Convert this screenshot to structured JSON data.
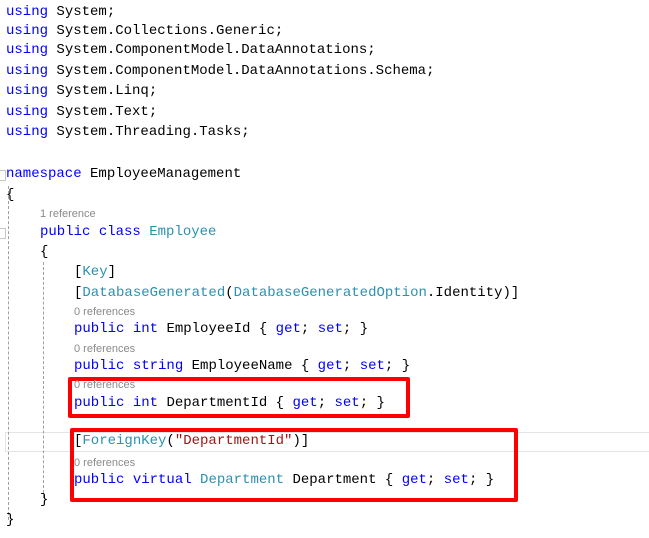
{
  "editor": {
    "lines": [
      {
        "indent": 0,
        "tokens": [
          {
            "t": "using",
            "c": "kw"
          },
          {
            "t": " System;",
            "c": "pl"
          }
        ]
      },
      {
        "indent": 0,
        "tokens": [
          {
            "t": "using",
            "c": "kw"
          },
          {
            "t": " System.Collections.Generic;",
            "c": "pl"
          }
        ]
      },
      {
        "indent": 0,
        "tokens": [
          {
            "t": "using",
            "c": "kw"
          },
          {
            "t": " System.ComponentModel.DataAnnotations;",
            "c": "pl"
          }
        ]
      },
      {
        "indent": 0,
        "tokens": [
          {
            "t": "using",
            "c": "kw"
          },
          {
            "t": " System.ComponentModel.DataAnnotations.Schema;",
            "c": "pl"
          }
        ]
      },
      {
        "indent": 0,
        "tokens": [
          {
            "t": "using",
            "c": "kw"
          },
          {
            "t": " System.Linq;",
            "c": "pl"
          }
        ]
      },
      {
        "indent": 0,
        "tokens": [
          {
            "t": "using",
            "c": "kw"
          },
          {
            "t": " System.Text;",
            "c": "pl"
          }
        ]
      },
      {
        "indent": 0,
        "tokens": [
          {
            "t": "using",
            "c": "kw"
          },
          {
            "t": " System.Threading.Tasks;",
            "c": "pl"
          }
        ]
      },
      {
        "indent": 0,
        "tokens": [
          {
            "t": "namespace",
            "c": "kw"
          },
          {
            "t": " EmployeeManagement",
            "c": "pl"
          }
        ]
      },
      {
        "indent": 0,
        "tokens": [
          {
            "t": "{",
            "c": "pl"
          }
        ]
      },
      {
        "indent": 1,
        "reference": "1 reference",
        "tokens": [
          {
            "t": "public",
            "c": "kw"
          },
          {
            "t": " ",
            "c": "pl"
          },
          {
            "t": "class",
            "c": "kw"
          },
          {
            "t": " ",
            "c": "pl"
          },
          {
            "t": "Employee",
            "c": "ty"
          }
        ]
      },
      {
        "indent": 1,
        "tokens": [
          {
            "t": "{",
            "c": "pl"
          }
        ]
      },
      {
        "indent": 2,
        "tokens": [
          {
            "t": "[",
            "c": "pl"
          },
          {
            "t": "Key",
            "c": "ty"
          },
          {
            "t": "]",
            "c": "pl"
          }
        ]
      },
      {
        "indent": 2,
        "tokens": [
          {
            "t": "[",
            "c": "pl"
          },
          {
            "t": "DatabaseGenerated",
            "c": "ty"
          },
          {
            "t": "(",
            "c": "pl"
          },
          {
            "t": "DatabaseGeneratedOption",
            "c": "ty"
          },
          {
            "t": ".Identity)]",
            "c": "pl"
          }
        ]
      },
      {
        "indent": 2,
        "reference": "0 references",
        "tokens": [
          {
            "t": "public",
            "c": "kw"
          },
          {
            "t": " ",
            "c": "pl"
          },
          {
            "t": "int",
            "c": "kw"
          },
          {
            "t": " EmployeeId { ",
            "c": "pl"
          },
          {
            "t": "get",
            "c": "kw"
          },
          {
            "t": "; ",
            "c": "pl"
          },
          {
            "t": "set",
            "c": "kw"
          },
          {
            "t": "; }",
            "c": "pl"
          }
        ]
      },
      {
        "indent": 2,
        "reference": "0 references",
        "tokens": [
          {
            "t": "public",
            "c": "kw"
          },
          {
            "t": " ",
            "c": "pl"
          },
          {
            "t": "string",
            "c": "kw"
          },
          {
            "t": " EmployeeName { ",
            "c": "pl"
          },
          {
            "t": "get",
            "c": "kw"
          },
          {
            "t": "; ",
            "c": "pl"
          },
          {
            "t": "set",
            "c": "kw"
          },
          {
            "t": "; }",
            "c": "pl"
          }
        ]
      },
      {
        "indent": 2,
        "reference": "0 references",
        "tokens": [
          {
            "t": "public",
            "c": "kw"
          },
          {
            "t": " ",
            "c": "pl"
          },
          {
            "t": "int",
            "c": "kw"
          },
          {
            "t": " DepartmentId { ",
            "c": "pl"
          },
          {
            "t": "get",
            "c": "kw"
          },
          {
            "t": "; ",
            "c": "pl"
          },
          {
            "t": "set",
            "c": "kw"
          },
          {
            "t": "; }",
            "c": "pl"
          }
        ]
      },
      {
        "indent": 2,
        "tokens": [
          {
            "t": "[",
            "c": "pl"
          },
          {
            "t": "ForeignKey",
            "c": "ty"
          },
          {
            "t": "(",
            "c": "pl"
          },
          {
            "t": "\"DepartmentId\"",
            "c": "st"
          },
          {
            "t": ")]",
            "c": "pl"
          }
        ]
      },
      {
        "indent": 2,
        "reference": "0 references",
        "tokens": [
          {
            "t": "public",
            "c": "kw"
          },
          {
            "t": " ",
            "c": "pl"
          },
          {
            "t": "virtual",
            "c": "kw"
          },
          {
            "t": " ",
            "c": "pl"
          },
          {
            "t": "Department",
            "c": "ty"
          },
          {
            "t": " Department { ",
            "c": "pl"
          },
          {
            "t": "get",
            "c": "kw"
          },
          {
            "t": "; ",
            "c": "pl"
          },
          {
            "t": "set",
            "c": "kw"
          },
          {
            "t": "; }",
            "c": "pl"
          }
        ]
      },
      {
        "indent": 1,
        "tokens": [
          {
            "t": "}",
            "c": "pl"
          }
        ]
      },
      {
        "indent": 0,
        "tokens": [
          {
            "t": "}",
            "c": "pl"
          }
        ]
      }
    ]
  }
}
